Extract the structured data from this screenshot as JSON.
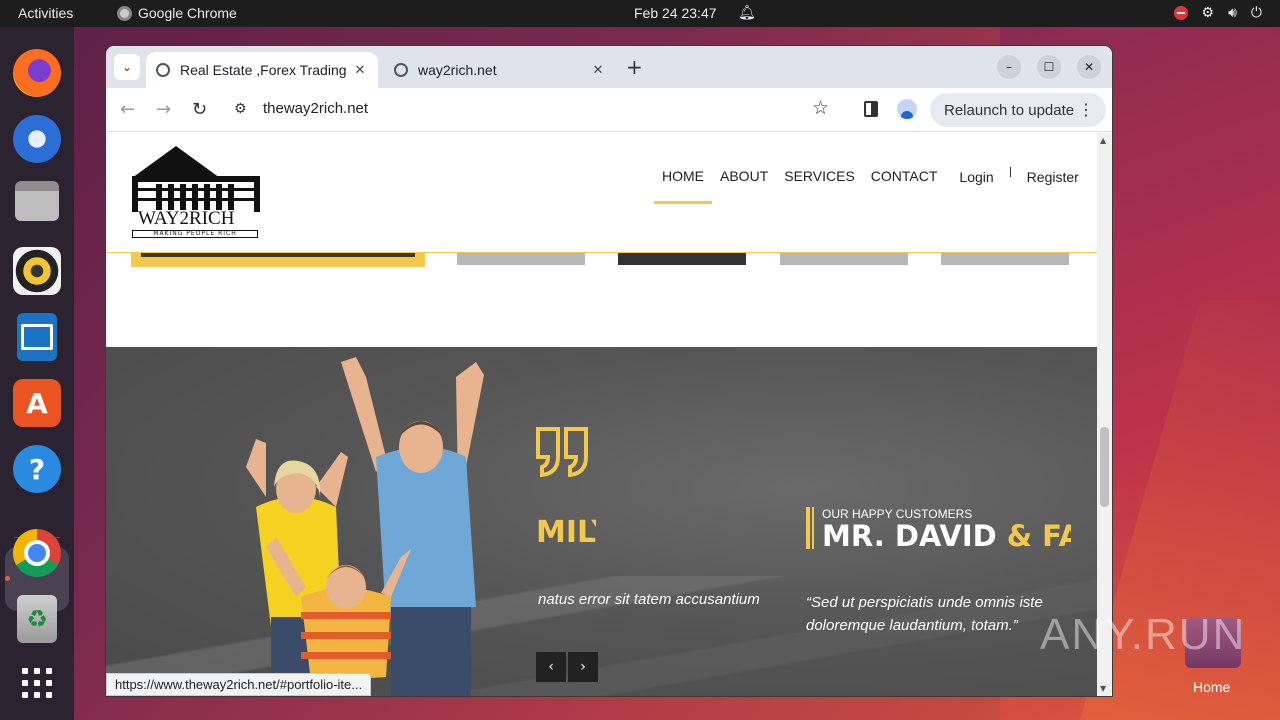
{
  "topbar": {
    "activities": "Activities",
    "app_name": "Google Chrome",
    "clock": "Feb 24  23:47"
  },
  "dock": {
    "items": [
      "firefox-icon",
      "thunderbird-icon",
      "files-icon",
      "rhythmbox-icon",
      "libreoffice-writer-icon",
      "app-center-icon",
      "help-icon",
      "chrome-icon",
      "trash-icon",
      "show-apps-icon"
    ]
  },
  "desktop": {
    "home_label": "Home"
  },
  "browser": {
    "tabs": [
      {
        "title": "Real Estate ,Forex Trading",
        "active": true
      },
      {
        "title": "way2rich.net",
        "active": false
      }
    ],
    "url": "theway2rich.net",
    "relaunch_label": "Relaunch to update",
    "status_url": "https://www.theway2rich.net/#portfolio-ite..."
  },
  "site": {
    "logo_name": "WAY2RICH",
    "logo_tagline": "MAKING PEOPLE RICH",
    "nav": {
      "home": "HOME",
      "about": "ABOUT",
      "services": "SERVICES",
      "contact": "CONTACT",
      "login": "Login",
      "register": "Register"
    },
    "testimonial": {
      "left_name_fragment": "MILY",
      "left_quote_fragment": "natus error sit tatem accusantium",
      "kicker": "OUR HAPPY CUSTOMERS",
      "name_main": "MR. DAVID ",
      "name_accent": "& FAMILY",
      "quote": "“Sed ut perspiciatis unde omnis iste doloremque laudantium, totam.”",
      "prev": "‹",
      "next": "›"
    }
  },
  "colors": {
    "accent": "#f2c94c",
    "topbar": "#1d1d1d",
    "dock": "#2b2330"
  },
  "watermark": "ANY.RUN"
}
